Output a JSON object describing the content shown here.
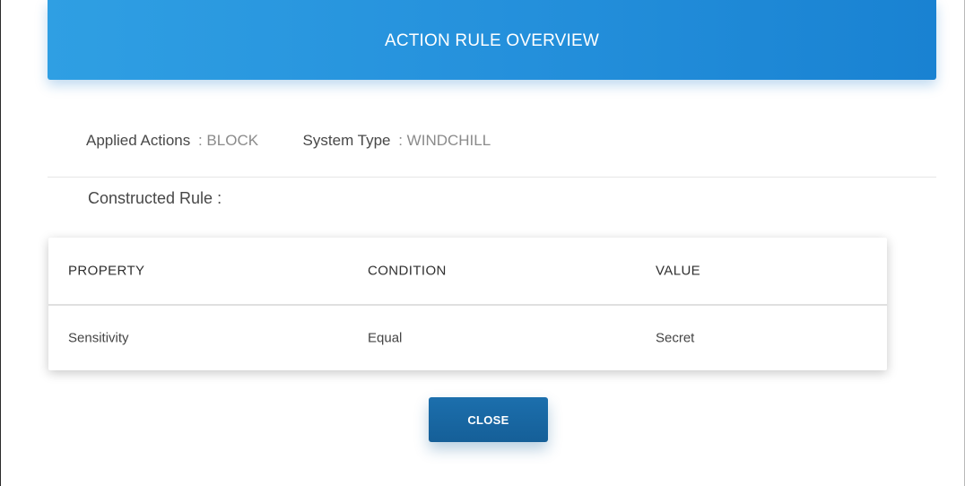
{
  "dialog": {
    "title": "ACTION RULE OVERVIEW"
  },
  "info": {
    "applied_actions_label": "Applied Actions",
    "applied_actions_value": ": BLOCK",
    "system_type_label": "System Type",
    "system_type_value": ": WINDCHILL"
  },
  "constructed_rule_label": "Constructed Rule :",
  "table": {
    "headers": [
      "PROPERTY",
      "CONDITION",
      "VALUE"
    ],
    "rows": [
      [
        "Sensitivity",
        "Equal",
        "Secret"
      ]
    ]
  },
  "buttons": {
    "close_label": "CLOSE"
  },
  "colors": {
    "header_gradient_start": "#2f9fe3",
    "header_gradient_end": "#1982d2",
    "button_color": "#1a69a6"
  }
}
